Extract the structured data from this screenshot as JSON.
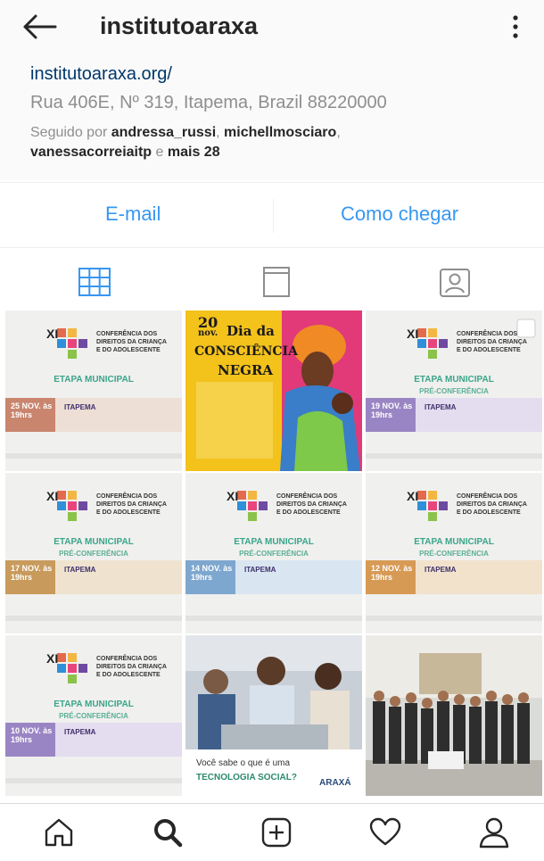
{
  "header": {
    "title": "institutoaraxa",
    "back_icon": "back-arrow-icon",
    "menu_icon": "more-vertical-icon"
  },
  "profile": {
    "website": "institutoaraxa.org/",
    "address": "Rua 406E, Nº 319, Itapema, Brazil 88220000",
    "followed_prefix": "Seguido por ",
    "followers": [
      "andressa_russi",
      "michellmosciaro",
      "vanessacorreiaitp"
    ],
    "followed_and": " e ",
    "followed_more": "mais 28"
  },
  "actions": {
    "email": "E-mail",
    "directions": "Como chegar"
  },
  "tabs": [
    "grid-icon",
    "feed-icon",
    "tagged-icon"
  ],
  "colors": {
    "link": "#3897f0",
    "website": "#00376b",
    "stage_green": "#3aa58a"
  },
  "posts": {
    "cnda_xi": "XI",
    "cnda_text": "CONFERÊNCIA DOS DIREITOS DA CRIANÇA E DO ADOLESCENTE",
    "stage": "ETAPA MUNICIPAL",
    "pre": "PRÉ-CONFERÊNCIA",
    "p1_date": "25 NOV. às 19hrs",
    "p1_loc": "ITAPEMA",
    "p2_day": "20",
    "p2_month": "nov.",
    "p2_title1": "Dia da",
    "p2_title2": "CONSCIÊNCIA",
    "p2_title3": "NEGRA",
    "p3_date": "19 NOV. às 19hrs",
    "p3_loc": "ITAPEMA",
    "p4_date": "17 NOV. às 19hrs",
    "p4_loc": "ITAPEMA",
    "p5_date": "14 NOV. às 19hrs",
    "p5_loc": "ITAPEMA",
    "p6_date": "12 NOV. às 19hrs",
    "p6_loc": "ITAPEMA",
    "p7_date": "10 NOV. às 19hrs",
    "p7_loc": "ITAPEMA",
    "p8_question": "Você sabe o que é uma",
    "p8_topic": "TECNOLOGIA SOCIAL?",
    "p8_logo": "ARAXÁ"
  },
  "bottom_nav": [
    "home-icon",
    "search-icon",
    "add-post-icon",
    "activity-heart-icon",
    "profile-icon"
  ]
}
